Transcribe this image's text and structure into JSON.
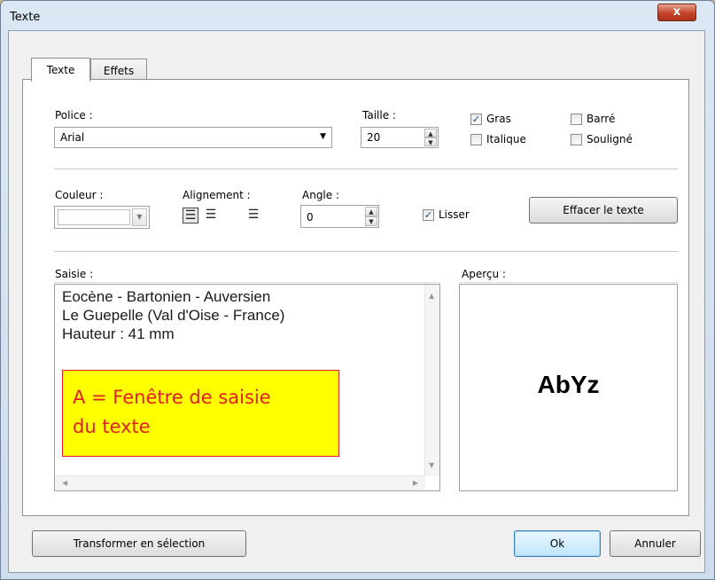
{
  "window": {
    "title": "Texte",
    "close_label": "x"
  },
  "tabs": [
    {
      "label": "Texte"
    },
    {
      "label": "Effets"
    }
  ],
  "font": {
    "label": "Police :",
    "value": "Arial"
  },
  "size": {
    "label": "Taille :",
    "value": "20"
  },
  "style_options": {
    "bold": {
      "label": "Gras",
      "checked": true
    },
    "italic": {
      "label": "Italique",
      "checked": false
    },
    "strike": {
      "label": "Barré",
      "checked": false
    },
    "underline": {
      "label": "Souligné",
      "checked": false
    }
  },
  "color": {
    "label": "Couleur :"
  },
  "alignment": {
    "label": "Alignement :",
    "options": [
      "left",
      "center",
      "right"
    ],
    "selected": "left"
  },
  "angle": {
    "label": "Angle :",
    "value": "0"
  },
  "smooth": {
    "label": "Lisser",
    "checked": true
  },
  "clear_button": "Effacer le texte",
  "input": {
    "label": "Saisie :",
    "lines": [
      "Eocène - Bartonien - Auversien",
      "Le Guepelle (Val d'Oise - France)",
      "Hauteur : 41 mm"
    ]
  },
  "annotation": {
    "lines": [
      "A = Fenêtre de saisie",
      "du texte"
    ]
  },
  "preview": {
    "label": "Aperçu :",
    "text": "AbYz"
  },
  "footer": {
    "transform_button": "Transformer en sélection",
    "ok_button": "Ok",
    "cancel_button": "Annuler"
  }
}
